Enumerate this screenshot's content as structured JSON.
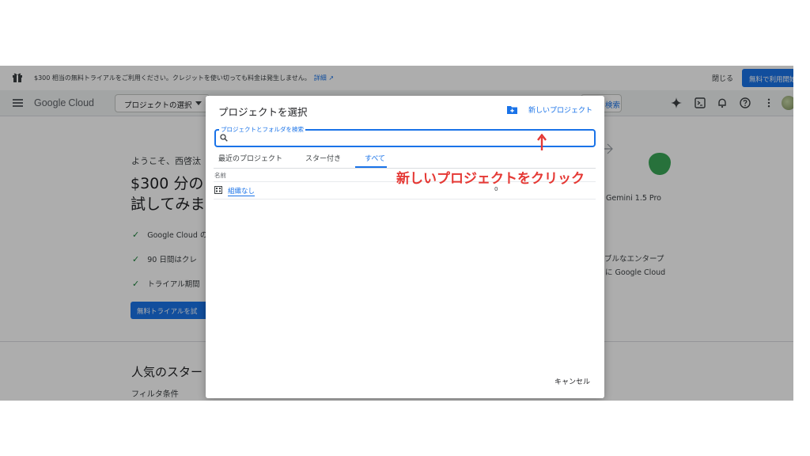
{
  "banner": {
    "text": "$300 相当の無料トライアルをご利用ください。クレジットを使い切っても料金は発生しません。",
    "link": "詳細",
    "close_label": "閉じる",
    "cta_label": "無料で利用開始"
  },
  "header": {
    "logo_word": "Google",
    "logo_product": "Cloud",
    "project_picker_label": "プロジェクトの選択",
    "search_label": "検索"
  },
  "background": {
    "welcome": "ようこそ、西啓汰",
    "headline1": "$300 分の",
    "headline2": "試してみま",
    "checks": [
      "Google Cloud の",
      "90 日間はクレ",
      "トライアル期間"
    ],
    "trial_button": "無料トライアルを試",
    "right_gemini": "Gemini 1.5 Pro",
    "right_enterprise": "ブルなエンタープ",
    "right_cloud": "に Google Cloud",
    "popular": "人気のスター",
    "filter": "フィルタ条件"
  },
  "dialog": {
    "title": "プロジェクトを選択",
    "new_project": "新しいプロジェクト",
    "search_label": "プロジェクトとフォルダを検索",
    "search_value": "",
    "tabs": [
      "最近のプロジェクト",
      "スター付き",
      "すべて"
    ],
    "active_tab": "すべて",
    "column_name": "名前",
    "rows": [
      {
        "name": "組織なし",
        "count": "0"
      }
    ],
    "cancel": "キャンセル"
  },
  "annotation": {
    "text": "新しいプロジェクトをクリック",
    "color": "#e53935"
  },
  "colors": {
    "accent": "#1a73e8",
    "success": "#188038"
  }
}
